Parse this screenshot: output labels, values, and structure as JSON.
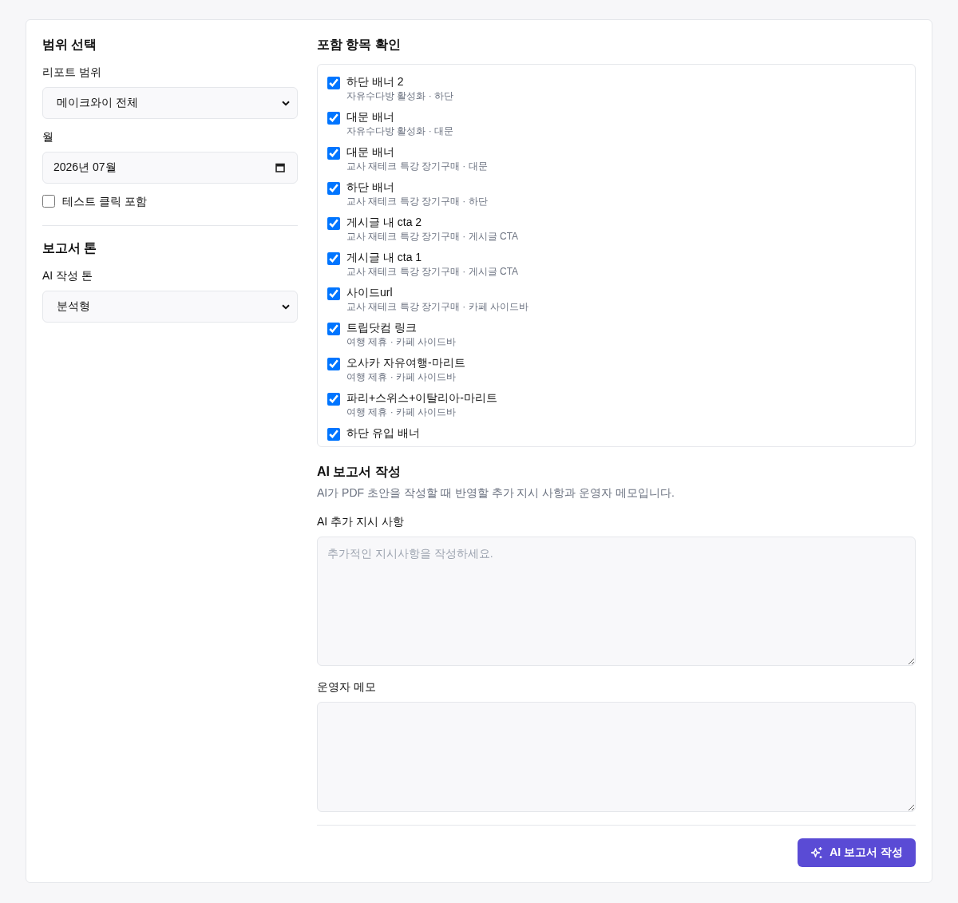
{
  "scope_panel": {
    "title": "범위 선택",
    "report_scope": {
      "label": "리포트 범위",
      "value": "메이크와이 전체"
    },
    "month": {
      "label": "월",
      "value": "2026년 07월"
    },
    "include_test_clicks": {
      "label": "테스트 클릭 포함",
      "checked": false
    }
  },
  "tone_panel": {
    "title": "보고서 톤",
    "ai_tone": {
      "label": "AI 작성 톤",
      "value": "분석형"
    }
  },
  "included_items": {
    "title": "포함 항목 확인",
    "items": [
      {
        "name": "하단 배너 2",
        "detail": "자유수다방 활성화 · 하단",
        "checked": true
      },
      {
        "name": "대문 배너",
        "detail": "자유수다방 활성화 · 대문",
        "checked": true
      },
      {
        "name": "대문 배너",
        "detail": "교사 재테크 특강 장기구매 · 대문",
        "checked": true
      },
      {
        "name": "하단 배너",
        "detail": "교사 재테크 특강 장기구매 · 하단",
        "checked": true
      },
      {
        "name": "게시글 내 cta 2",
        "detail": "교사 재테크 특강 장기구매 · 게시글 CTA",
        "checked": true
      },
      {
        "name": "게시글 내 cta 1",
        "detail": "교사 재테크 특강 장기구매 · 게시글 CTA",
        "checked": true
      },
      {
        "name": "사이드url",
        "detail": "교사 재테크 특강 장기구매 · 카페 사이드바",
        "checked": true
      },
      {
        "name": "트립닷컴 링크",
        "detail": "여행 제휴 · 카페 사이드바",
        "checked": true
      },
      {
        "name": "오사카 자유여행-마리트",
        "detail": "여행 제휴 · 카페 사이드바",
        "checked": true
      },
      {
        "name": "파리+스위스+이탈리아-마리트",
        "detail": "여행 제휴 · 카페 사이드바",
        "checked": true
      },
      {
        "name": "하단 유입 배너",
        "checked": true
      }
    ]
  },
  "ai_report": {
    "title": "AI 보고서 작성",
    "description": "AI가 PDF 초안을 작성할 때 반영할 추가 지시 사항과 운영자 메모입니다.",
    "instructions": {
      "label": "AI 추가 지시 사항",
      "placeholder": "추가적인 지시사항을 작성하세요."
    },
    "operator_memo": {
      "label": "운영자 메모"
    },
    "submit_button": "AI 보고서 작성"
  }
}
